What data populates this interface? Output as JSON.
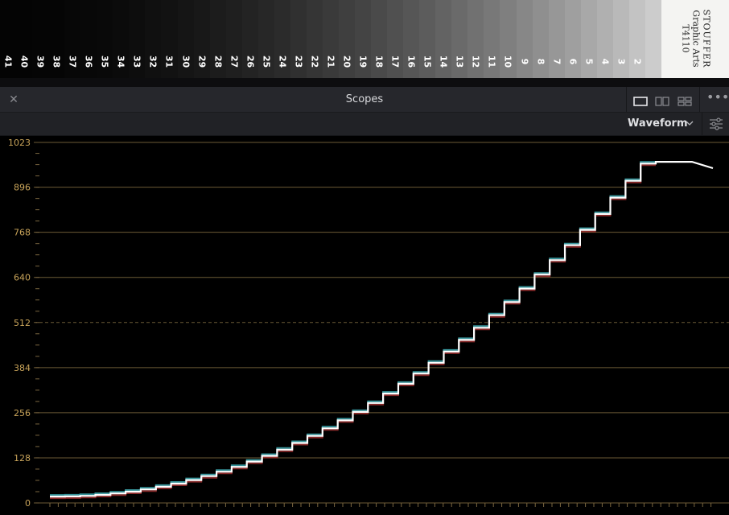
{
  "viewer": {
    "step_numbers": [
      "41",
      "40",
      "39",
      "38",
      "37",
      "36",
      "35",
      "34",
      "33",
      "32",
      "31",
      "30",
      "29",
      "28",
      "27",
      "26",
      "25",
      "24",
      "23",
      "22",
      "21",
      "20",
      "19",
      "18",
      "17",
      "16",
      "15",
      "14",
      "13",
      "12",
      "11",
      "10",
      "9",
      "8",
      "7",
      "6",
      "5",
      "4",
      "3",
      "2"
    ],
    "brand_line1": "STOUFFER",
    "brand_line2": "Graphic Arts",
    "brand_line3": "T4110"
  },
  "panel": {
    "title": "Scopes",
    "close_icon": "close-icon",
    "layout_icons": [
      "single-view-icon",
      "dual-view-icon",
      "quad-view-icon"
    ],
    "more_icon": "more-icon"
  },
  "toolbar": {
    "mode_label": "Waveform",
    "mode_icon": "chevron-down-icon",
    "settings_icon": "sliders-icon"
  },
  "scope": {
    "y_labels": [
      "1023",
      "896",
      "768",
      "640",
      "512",
      "384",
      "256",
      "128",
      "0"
    ],
    "y_values": [
      1023,
      896,
      768,
      640,
      512,
      384,
      256,
      128,
      0
    ],
    "grid_color": "#6b5a36",
    "label_color": "#c9a45a",
    "trace_color": "#ffffff"
  }
}
